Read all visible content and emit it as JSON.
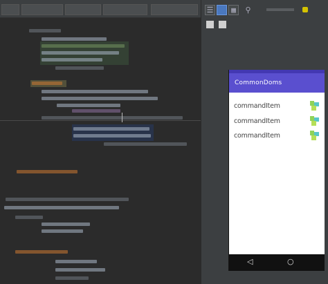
{
  "preview": {
    "app_title": "CommonDoms",
    "list": [
      {
        "label": "commandItem"
      },
      {
        "label": "commandItem"
      },
      {
        "label": "commandItem"
      }
    ],
    "nav": {
      "back": "◁",
      "home": "○"
    }
  },
  "toolbar": {
    "icons": [
      "layout-icon",
      "split-view-icon",
      "design-icon",
      "palette-icon",
      "zoom-icon"
    ]
  },
  "colors": {
    "app_bar": "#5a4fcf",
    "status_bar": "#4338b2",
    "editor_bg": "#2b2b2b",
    "panel_bg": "#3c3f41"
  }
}
